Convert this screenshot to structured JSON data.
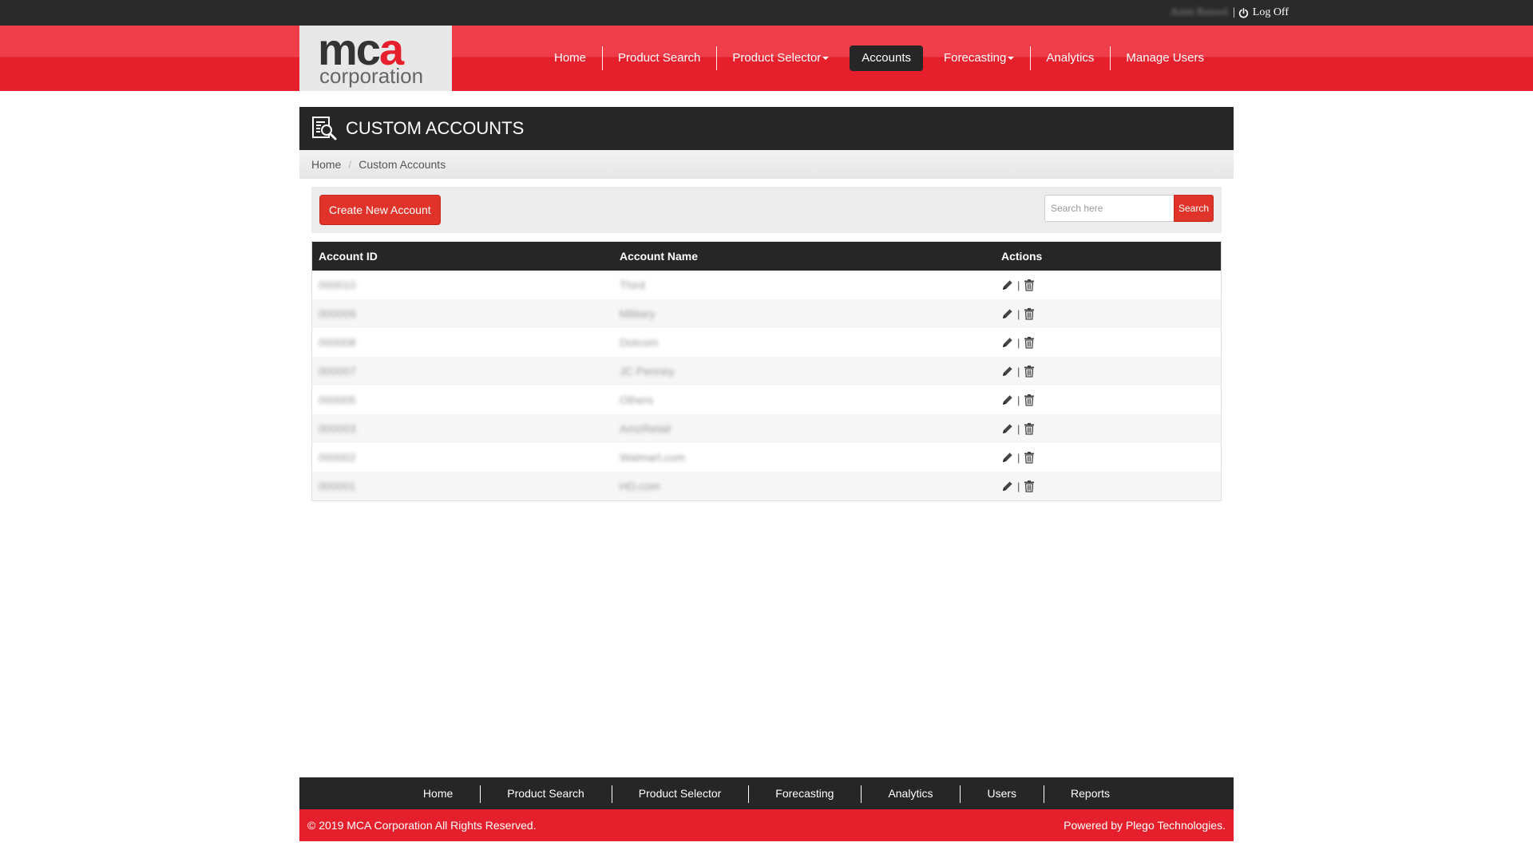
{
  "topbar": {
    "user_name": "Asim Rasool",
    "separator": "|",
    "logoff_label": "Log Off"
  },
  "logo": {
    "brand_mc": "mc",
    "brand_a": "a",
    "subtitle": "corporation"
  },
  "nav": {
    "items": [
      {
        "label": "Home"
      },
      {
        "label": "Product Search"
      },
      {
        "label": "Product Selector"
      },
      {
        "label": "Accounts"
      },
      {
        "label": "Forecasting"
      },
      {
        "label": "Analytics"
      },
      {
        "label": "Manage Users"
      }
    ],
    "active": "Accounts"
  },
  "page": {
    "title": "CUSTOM ACCOUNTS",
    "breadcrumb": [
      "Home",
      "Custom Accounts"
    ],
    "breadcrumb_divider": "/"
  },
  "toolbar": {
    "create_label": "Create New Account",
    "search_placeholder": "Search here",
    "search_label": "Search"
  },
  "table": {
    "headers": [
      "Account ID",
      "Account Name",
      "Actions"
    ],
    "rows": [
      {
        "id": "000010",
        "name": "Third"
      },
      {
        "id": "000009",
        "name": "Military"
      },
      {
        "id": "000008",
        "name": "Dotcom"
      },
      {
        "id": "000007",
        "name": "JC Penney"
      },
      {
        "id": "000005",
        "name": "Others"
      },
      {
        "id": "000003",
        "name": "AmzRetail"
      },
      {
        "id": "000002",
        "name": "Walmart.com"
      },
      {
        "id": "000001",
        "name": "HD.com"
      }
    ],
    "action_separator": "|"
  },
  "footer": {
    "nav": [
      "Home",
      "Product Search",
      "Product Selector",
      "Forecasting",
      "Analytics",
      "Users",
      "Reports"
    ],
    "copyright": "© 2019 MCA Corporation All Rights Reserved.",
    "powered_by": "Powered by Plego Technologies."
  },
  "colors": {
    "brand_red": "#e5202c",
    "dark": "#262626",
    "button_red": "#e0332a"
  },
  "icons": {
    "logoff": "power-icon",
    "title": "document-search-icon",
    "edit": "pencil-icon",
    "delete": "trash-icon"
  }
}
